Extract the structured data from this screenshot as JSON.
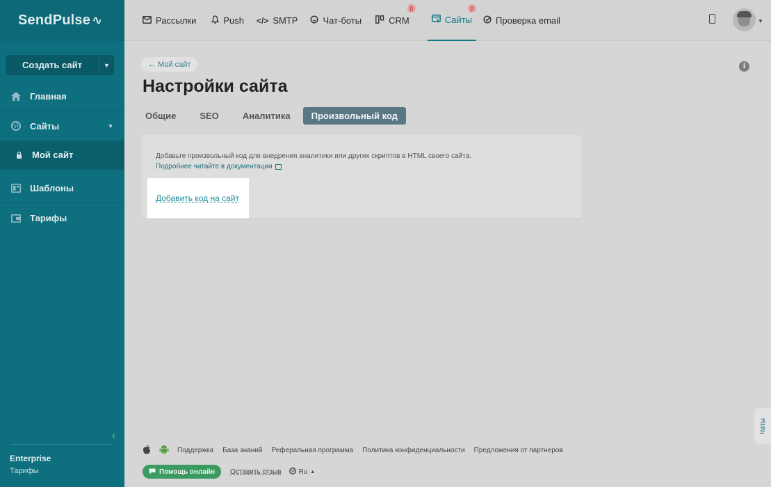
{
  "brand": {
    "logo_text": "SendPulse",
    "pulse_glyph": "∿"
  },
  "sidebar": {
    "create_button": "Создать сайт",
    "items": [
      {
        "label": "Главная",
        "icon": "home-icon"
      },
      {
        "label": "Сайты",
        "icon": "globe-icon"
      },
      {
        "label": "Мой сайт",
        "icon": "lock-icon"
      },
      {
        "label": "Шаблоны",
        "icon": "templates-icon"
      },
      {
        "label": "Тарифы",
        "icon": "wallet-icon"
      }
    ],
    "plan_name": "Enterprise",
    "plan_link": "Тарифы"
  },
  "topnav": {
    "items": [
      {
        "label": "Рассылки",
        "icon": "mail-icon"
      },
      {
        "label": "Push",
        "icon": "bell-icon"
      },
      {
        "label": "SMTP",
        "icon": "code-icon"
      },
      {
        "label": "Чат-боты",
        "icon": "chat-icon"
      },
      {
        "label": "CRM",
        "icon": "crm-icon",
        "badge": "β"
      },
      {
        "label": "Сайты",
        "icon": "sites-icon",
        "badge": "β",
        "active": true
      },
      {
        "label": "Проверка email",
        "icon": "check-icon"
      }
    ]
  },
  "main": {
    "back_link": "← Мой сайт",
    "page_title": "Настройки сайта",
    "tabs": [
      {
        "label": "Общие"
      },
      {
        "label": "SEO"
      },
      {
        "label": "Аналитика"
      },
      {
        "label": "Произвольный код",
        "active": true
      }
    ],
    "card": {
      "description": "Добавьте произвольный код для внедрения аналитики или других скриптов в HTML своего сайта.",
      "docs_link": "Подробнее читайте в документации",
      "add_code_link": "Добавить код на сайт"
    }
  },
  "footer": {
    "links": [
      "Поддержка",
      "База знаний",
      "Реферальная программа",
      "Политика конфиденциальности",
      "Предложения от партнеров"
    ],
    "help_button": "Помощь онлайн",
    "feedback_link": "Оставить отзыв",
    "language": "Ru"
  },
  "chats_tab": "Чаты",
  "colors": {
    "sidebar_bg": "#0e6f7f",
    "accent": "#11798a",
    "help_green": "#3a9a60",
    "active_tab": "#5a7884"
  }
}
